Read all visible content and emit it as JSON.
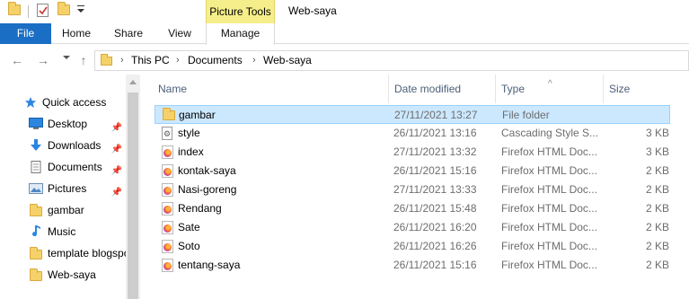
{
  "titlebar": {
    "contextual_tab": "Picture Tools",
    "window_title": "Web-saya"
  },
  "ribbon": {
    "tabs": [
      "File",
      "Home",
      "Share",
      "View",
      "Manage"
    ]
  },
  "address": {
    "crumbs": [
      "This PC",
      "Documents",
      "Web-saya"
    ]
  },
  "sidebar": {
    "items": [
      {
        "label": "Quick access",
        "icon": "star-icon"
      },
      {
        "label": "Desktop",
        "icon": "desktop-icon",
        "pinned": true
      },
      {
        "label": "Downloads",
        "icon": "download-icon",
        "pinned": true
      },
      {
        "label": "Documents",
        "icon": "documents-icon",
        "pinned": true
      },
      {
        "label": "Pictures",
        "icon": "pictures-icon",
        "pinned": true
      },
      {
        "label": "gambar",
        "icon": "folder-icon"
      },
      {
        "label": "Music",
        "icon": "music-icon"
      },
      {
        "label": "template blogspot",
        "icon": "folder-icon"
      },
      {
        "label": "Web-saya",
        "icon": "folder-icon"
      }
    ]
  },
  "filelist": {
    "columns": {
      "name": "Name",
      "date": "Date modified",
      "type": "Type",
      "size": "Size"
    },
    "rows": [
      {
        "name": "gambar",
        "date": "27/11/2021 13:27",
        "type": "File folder",
        "size": "",
        "icon": "folder-icon",
        "selected": true
      },
      {
        "name": "style",
        "date": "26/11/2021 13:16",
        "type": "Cascading Style S...",
        "size": "3 KB",
        "icon": "css-file-icon"
      },
      {
        "name": "index",
        "date": "27/11/2021 13:32",
        "type": "Firefox HTML Doc...",
        "size": "3 KB",
        "icon": "firefox-html-icon"
      },
      {
        "name": "kontak-saya",
        "date": "26/11/2021 15:16",
        "type": "Firefox HTML Doc...",
        "size": "2 KB",
        "icon": "firefox-html-icon"
      },
      {
        "name": "Nasi-goreng",
        "date": "27/11/2021 13:33",
        "type": "Firefox HTML Doc...",
        "size": "2 KB",
        "icon": "firefox-html-icon"
      },
      {
        "name": "Rendang",
        "date": "26/11/2021 15:48",
        "type": "Firefox HTML Doc...",
        "size": "2 KB",
        "icon": "firefox-html-icon"
      },
      {
        "name": "Sate",
        "date": "26/11/2021 16:20",
        "type": "Firefox HTML Doc...",
        "size": "2 KB",
        "icon": "firefox-html-icon"
      },
      {
        "name": "Soto",
        "date": "26/11/2021 16:26",
        "type": "Firefox HTML Doc...",
        "size": "2 KB",
        "icon": "firefox-html-icon"
      },
      {
        "name": "tentang-saya",
        "date": "26/11/2021 15:16",
        "type": "Firefox HTML Doc...",
        "size": "2 KB",
        "icon": "firefox-html-icon"
      }
    ]
  },
  "colors": {
    "file_tab": "#1a6fc4",
    "contextual_tab": "#f6ee8a",
    "selection": "#cce8ff",
    "header_text": "#4c607a"
  }
}
